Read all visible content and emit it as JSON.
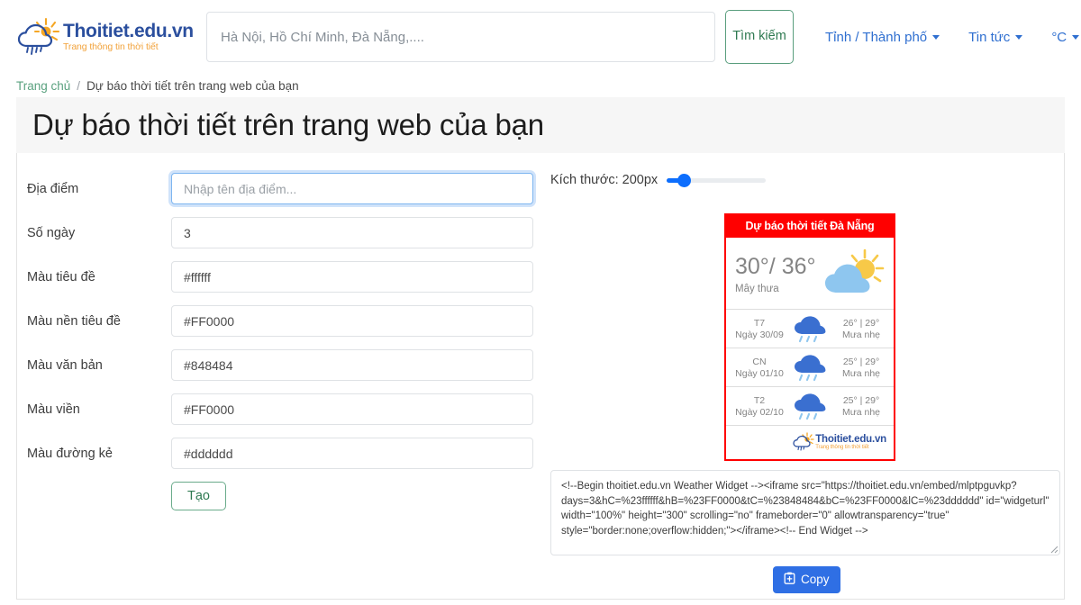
{
  "header": {
    "logo": {
      "title": "Thoitiet.edu.vn",
      "subtitle": "Trang thông tin thời tiết",
      "icon": "sun-cloud-rain-icon"
    },
    "search": {
      "placeholder": "Hà Nội, Hồ Chí Minh, Đà Nẵng,....",
      "value": "",
      "button_label": "Tìm kiếm"
    },
    "nav": [
      {
        "label": "Tỉnh / Thành phố",
        "has_dropdown": true
      },
      {
        "label": "Tin tức",
        "has_dropdown": true
      },
      {
        "label": "°C",
        "has_dropdown": true
      }
    ]
  },
  "breadcrumb": {
    "home": "Trang chủ",
    "separator": "/",
    "current": "Dự báo thời tiết trên trang web của bạn"
  },
  "page_title": "Dự báo thời tiết trên trang web của bạn",
  "form": {
    "fields": [
      {
        "label": "Địa điểm",
        "value": "",
        "placeholder": "Nhập tên địa điểm...",
        "focused": true
      },
      {
        "label": "Số ngày",
        "value": "3",
        "placeholder": "",
        "focused": false
      },
      {
        "label": "Màu tiêu đề",
        "value": "#ffffff",
        "placeholder": "",
        "focused": false
      },
      {
        "label": "Màu nền tiêu đề",
        "value": "#FF0000",
        "placeholder": "",
        "focused": false
      },
      {
        "label": "Màu văn bản",
        "value": "#848484",
        "placeholder": "",
        "focused": false
      },
      {
        "label": "Màu viền",
        "value": "#FF0000",
        "placeholder": "",
        "focused": false
      },
      {
        "label": "Màu đường kẻ",
        "value": "#dddddd",
        "placeholder": "",
        "focused": false
      }
    ],
    "create_button": "Tạo"
  },
  "preview": {
    "size_label": "Kích thước: 200px",
    "size_value": 200,
    "widget": {
      "title": "Dự báo thời tiết Đà Nẵng",
      "header_bg": "#FF0000",
      "header_color": "#ffffff",
      "border_color": "#FF0000",
      "line_color": "#dddddd",
      "text_color": "#848484",
      "current": {
        "temperature": "30°/ 36°",
        "description": "Mây thưa",
        "icon": "sun-cloud-icon"
      },
      "forecast": [
        {
          "dow": "T7",
          "date": "Ngày 30/09",
          "icon": "rain-cloud-icon",
          "range": "26° | 29°",
          "condition": "Mưa nhẹ"
        },
        {
          "dow": "CN",
          "date": "Ngày 01/10",
          "icon": "rain-cloud-icon",
          "range": "25° | 29°",
          "condition": "Mưa nhẹ"
        },
        {
          "dow": "T2",
          "date": "Ngày 02/10",
          "icon": "rain-cloud-icon",
          "range": "25° | 29°",
          "condition": "Mưa nhẹ"
        }
      ],
      "footer_logo": {
        "title": "Thoitiet.edu.vn",
        "subtitle": "Trang thông tin thời tiết"
      }
    }
  },
  "embed": {
    "code": "<!--Begin thoitiet.edu.vn Weather Widget --><iframe src=\"https://thoitiet.edu.vn/embed/mlptpguvkp?days=3&hC=%23ffffff&hB=%23FF0000&tC=%23848484&bC=%23FF0000&lC=%23dddddd\" id=\"widgeturl\" width=\"100%\" height=\"300\" scrolling=\"no\" frameborder=\"0\" allowtransparency=\"true\" style=\"border:none;overflow:hidden;\"></iframe><!-- End Widget -->",
    "copy_label": "Copy"
  }
}
